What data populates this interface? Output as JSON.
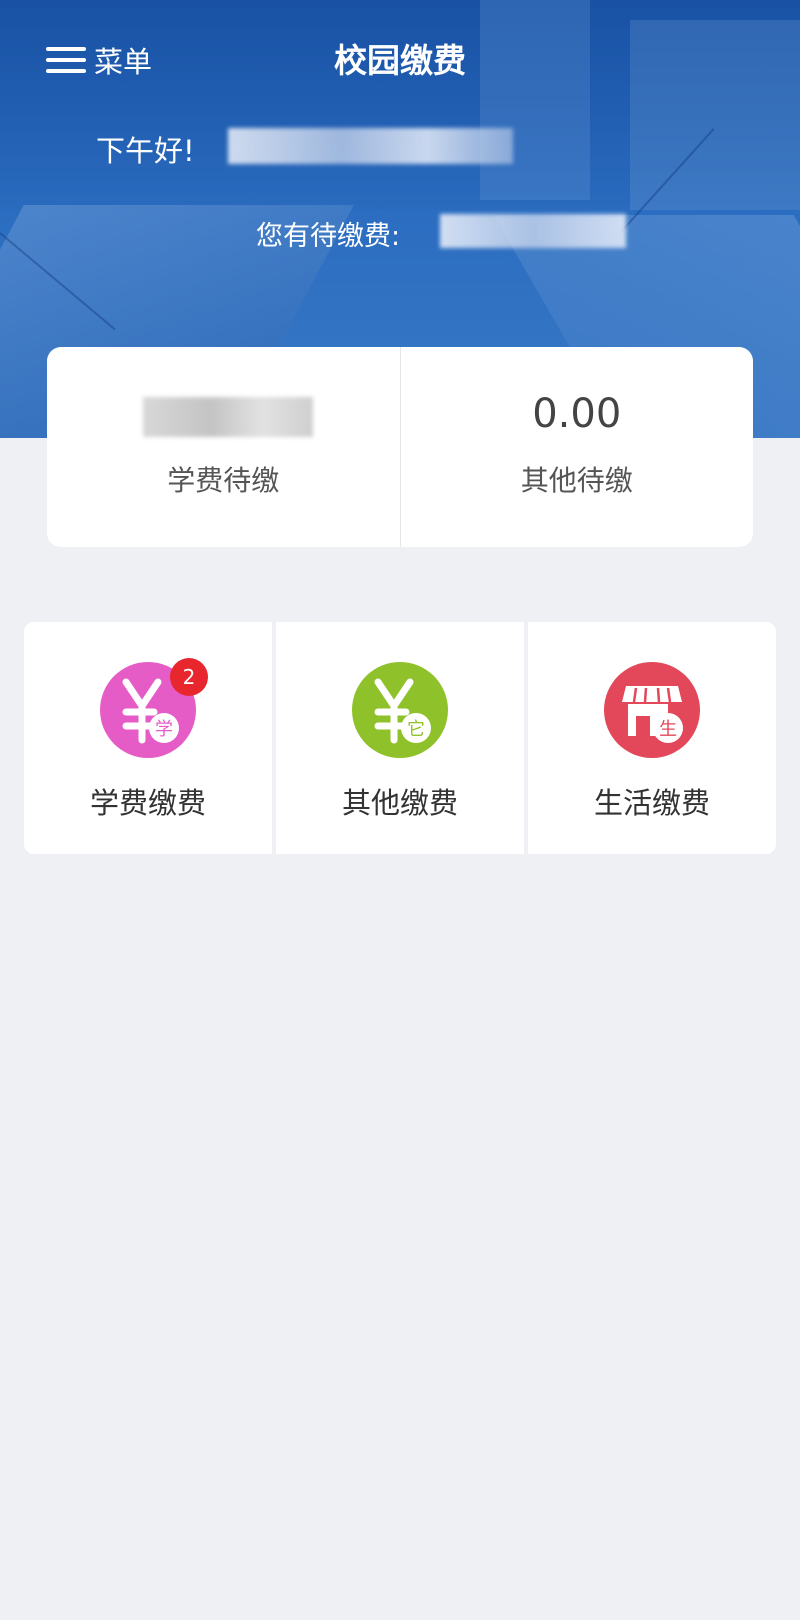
{
  "header": {
    "menu_label": "菜单",
    "title": "校园缴费",
    "greeting": "下午好!",
    "pending_label": "您有待缴费:"
  },
  "summary": {
    "tuition_label": "学费待缴",
    "other_amount": "0.00",
    "other_label": "其他待缴"
  },
  "services": [
    {
      "label": "学费缴费",
      "icon": "tuition-yen-icon",
      "icon_char": "学",
      "color": "#e65cc6",
      "badge": "2"
    },
    {
      "label": "其他缴费",
      "icon": "other-yen-icon",
      "icon_char": "它",
      "color": "#8fc22a"
    },
    {
      "label": "生活缴费",
      "icon": "store-icon",
      "icon_char": "生",
      "color": "#e2485a"
    }
  ],
  "colors": {
    "banner": "#2a6cc0",
    "background": "#eff0f4",
    "badge": "#e8262e"
  }
}
